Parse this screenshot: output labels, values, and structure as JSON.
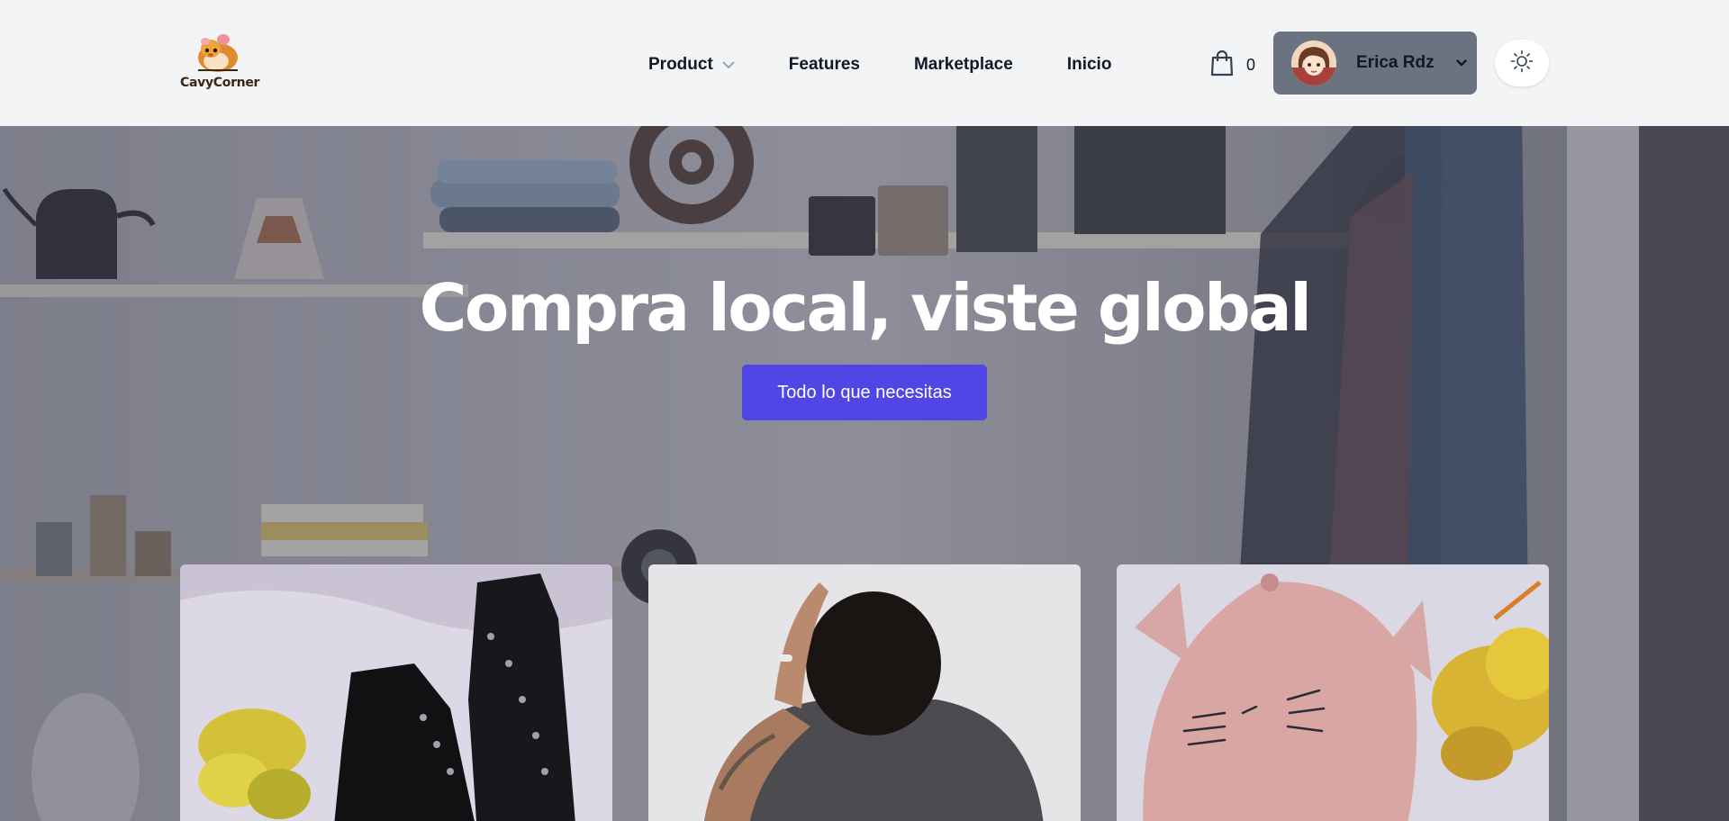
{
  "brand": {
    "name": "CavyCorner"
  },
  "nav": {
    "items": [
      {
        "label": "Product",
        "has_dropdown": true
      },
      {
        "label": "Features"
      },
      {
        "label": "Marketplace"
      },
      {
        "label": "Inicio"
      }
    ]
  },
  "cart": {
    "icon": "shopping-bag-icon",
    "count": "0"
  },
  "user": {
    "name": "Erica Rdz",
    "avatar_icon": "avatar"
  },
  "theme_toggle": {
    "icon": "sun-icon"
  },
  "hero": {
    "title": "Compra local, viste global",
    "cta_label": "Todo lo que necesitas"
  },
  "products": [
    {
      "image": "black-studded-boots"
    },
    {
      "image": "man-in-gray-tshirt"
    },
    {
      "image": "pink-cat-cap"
    }
  ],
  "colors": {
    "accent": "#4f46e5",
    "user_button": "#6b7280",
    "header_bg": "#f3f4f6"
  }
}
